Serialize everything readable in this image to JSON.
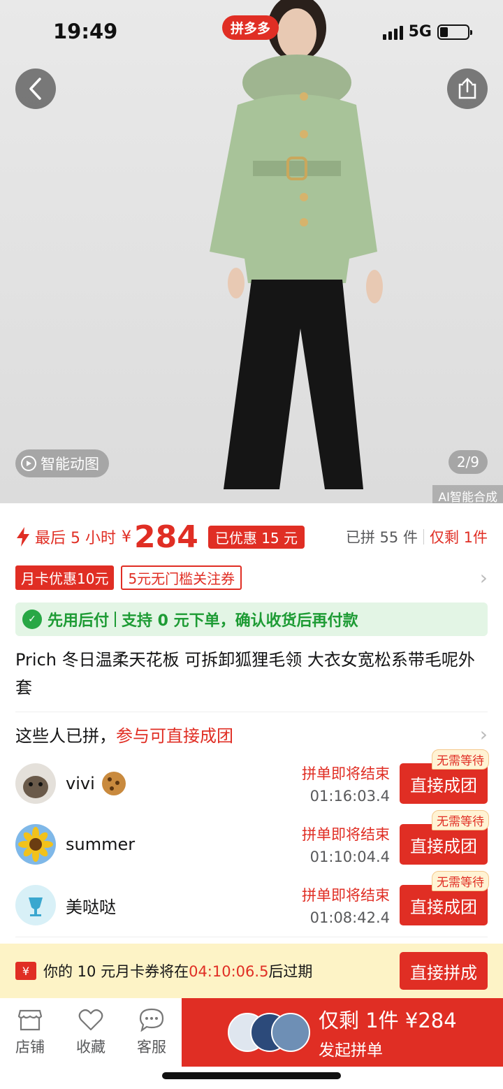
{
  "status": {
    "time": "19:49",
    "network": "5G",
    "battery_percent": 30
  },
  "brand_badge": "拼多多",
  "gallery": {
    "smart_tag": "智能动图",
    "page_indicator": "2/9",
    "ai_tag": "AI智能合成"
  },
  "price": {
    "countdown": "最后 5 小时",
    "currency": "¥",
    "amount": "284",
    "discount": "已优惠 15 元",
    "sold": "已拼 55 件",
    "remain": "仅剩 1件"
  },
  "coupons": [
    "月卡优惠10元",
    "5元无门槛关注券"
  ],
  "pay_later": {
    "title": "先用后付",
    "desc": "支持 0 元下单，确认收货后再付款"
  },
  "product_title": "Prich 冬日温柔天花板 可拆卸狐狸毛领 大衣女宽松系带毛呢外套",
  "group": {
    "heading": "这些人已拼，",
    "heading_highlight": "参与可直接成团",
    "rows": [
      {
        "name": "vivi",
        "status": "拼单即将结束",
        "time": "01:16:03.4",
        "button": "直接成团",
        "tag": "无需等待"
      },
      {
        "name": "summer",
        "status": "拼单即将结束",
        "time": "01:10:04.4",
        "button": "直接成团",
        "tag": "无需等待"
      },
      {
        "name": "美哒哒",
        "status": "拼单即将结束",
        "time": "01:08:42.4",
        "button": "直接成团",
        "tag": "无需等待"
      }
    ]
  },
  "expire": {
    "icon_text": "¥",
    "prefix": "你的 10 元月卡券将在",
    "time": "04:10:06.5",
    "suffix": "后过期",
    "button": "直接拼成"
  },
  "bottom": {
    "tabs": [
      "店铺",
      "收藏",
      "客服"
    ],
    "buy_main": "仅剩 1件 ¥284",
    "buy_sub": "发起拼单"
  },
  "colors": {
    "brand_red": "#e02e24",
    "paylater_green": "#1d9b34",
    "expire_bg": "#fdf3c6"
  }
}
